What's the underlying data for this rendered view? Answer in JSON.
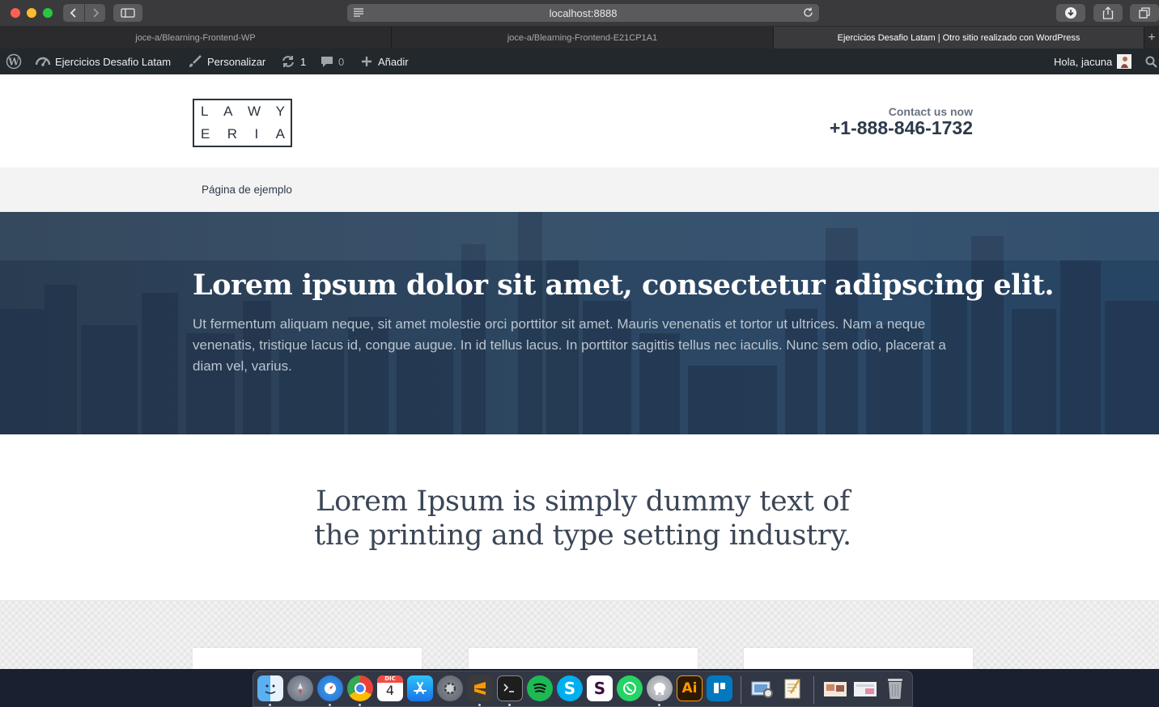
{
  "browser": {
    "url": "localhost:8888",
    "tabs": [
      {
        "label": "joce-a/Blearning-Frontend-WP",
        "active": false
      },
      {
        "label": "joce-a/Blearning-Frontend-E21CP1A1",
        "active": false
      },
      {
        "label": "Ejercicios Desafio Latam | Otro sitio realizado con WordPress",
        "active": true
      }
    ],
    "new_tab": "+"
  },
  "adminbar": {
    "site_name": "Ejercicios Desafio Latam",
    "customize": "Personalizar",
    "updates_count": "1",
    "comments_count": "0",
    "add_new": "Añadir",
    "greeting": "Hola, jacuna"
  },
  "site": {
    "logo_row1": [
      "L",
      "A",
      "W",
      "Y"
    ],
    "logo_row2": [
      "E",
      "R",
      "I",
      "A"
    ],
    "contact_label": "Contact us now",
    "contact_phone": "+1-888-846-1732",
    "menu": [
      "Página de ejemplo"
    ]
  },
  "hero": {
    "title": "Lorem ipsum dolor sit amet, consectetur adipscing elit.",
    "text": "Ut fermentum aliquam neque, sit amet molestie orci porttitor sit amet. Mauris venenatis et tortor ut ultrices. Nam a neque venenatis, tristique lacus id, congue augue. In id tellus lacus. In porttitor sagittis tellus nec iaculis. Nunc sem odio, placerat a diam vel, varius."
  },
  "intro": {
    "text": "Lorem Ipsum is simply dummy text of the printing and type setting industry."
  },
  "dock": {
    "calendar_day": "4",
    "calendar_month": "DIC",
    "illustrator_label": "Ai",
    "apps": [
      "finder-icon",
      "launchpad-icon",
      "safari-icon",
      "chrome-icon",
      "calendar-icon",
      "app-store-icon",
      "system-preferences-icon",
      "sublime-text-icon",
      "terminal-icon",
      "spotify-icon",
      "skype-icon",
      "slack-icon",
      "whatsapp-icon",
      "sequel-pro-icon",
      "illustrator-icon",
      "trello-icon",
      "preview-icon",
      "textedit-icon",
      "photos-folder-icon",
      "screenshots-folder-icon",
      "trash-icon"
    ]
  },
  "colors": {
    "admin_bar": "#23282d",
    "hero_overlay": "#2c4a68",
    "heading_dark": "#2d3a4a"
  }
}
